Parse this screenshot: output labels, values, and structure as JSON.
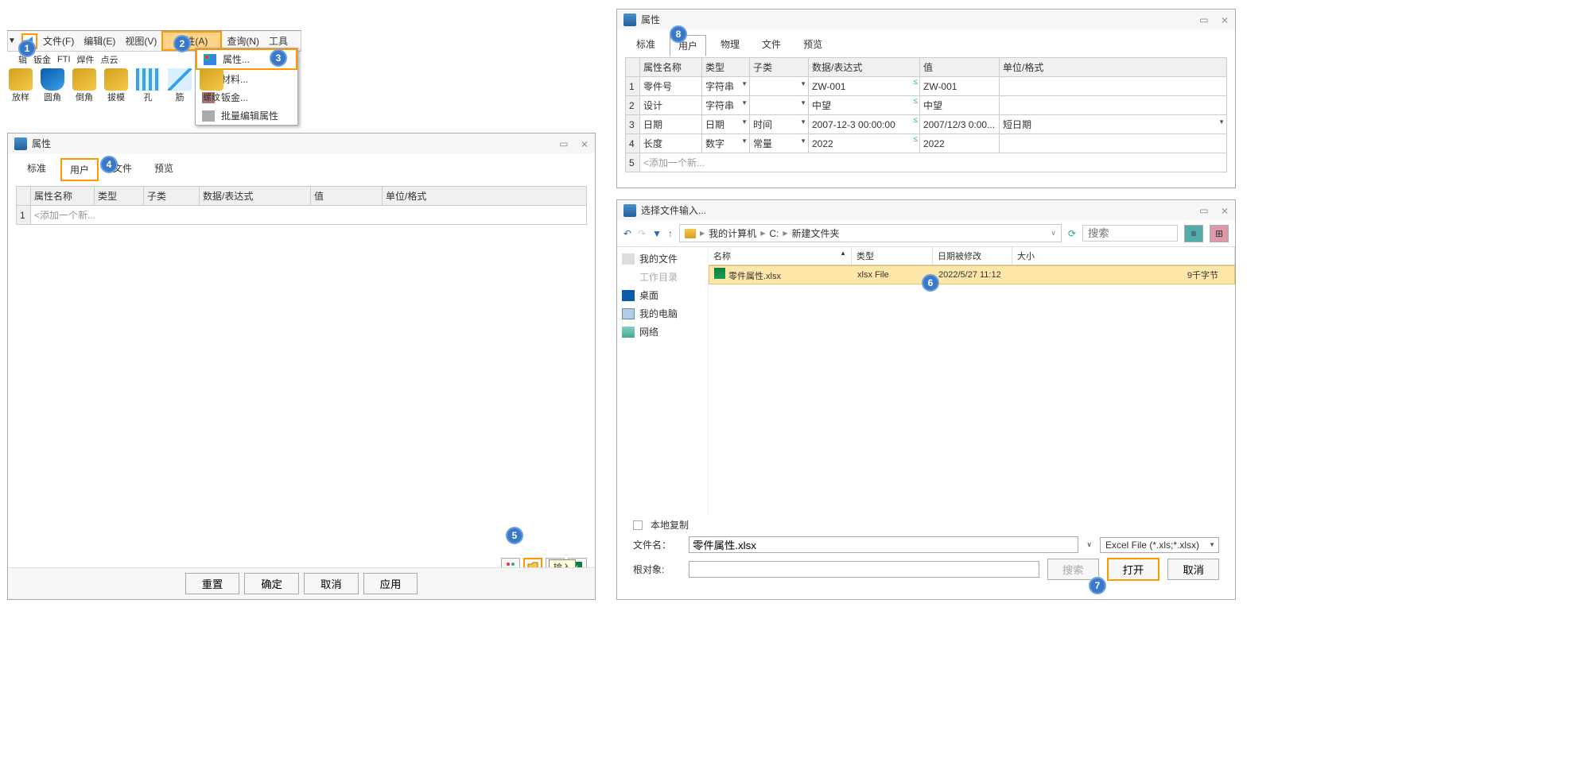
{
  "menu": {
    "items": [
      "文件(F)",
      "编辑(E)",
      "视图(V)",
      "属性(A)",
      "查询(N)",
      "工具"
    ],
    "sub_items": [
      "辑",
      "钣金",
      "FTI",
      "焊件",
      "点云"
    ]
  },
  "dropdown": {
    "items": [
      "属性...",
      "材料...",
      "钣金...",
      "批量编辑属性"
    ]
  },
  "toolbar": {
    "labels": [
      "放样",
      "圆角",
      "倒角",
      "拔模",
      "孔",
      "筋",
      "螺纹"
    ]
  },
  "prop_panel": {
    "title": "属性",
    "tabs": [
      "标准",
      "用户",
      "文件",
      "预览"
    ],
    "cols": [
      "",
      "属性名称",
      "类型",
      "子类",
      "数据/表达式",
      "值",
      "单位/格式"
    ],
    "placeholder": "<添加一个新...",
    "buttons": [
      "重置",
      "确定",
      "取消",
      "应用"
    ],
    "tooltip": "输入"
  },
  "prop_right": {
    "title": "属性",
    "tabs": [
      "标准",
      "用户",
      "物理",
      "文件",
      "预览"
    ],
    "cols": [
      "",
      "属性名称",
      "类型",
      "子类",
      "数据/表达式",
      "值",
      "单位/格式"
    ],
    "rows": [
      {
        "num": "1",
        "name": "零件号",
        "type": "字符串",
        "sub": "",
        "data": "ZW-001",
        "val": "ZW-001",
        "unit": ""
      },
      {
        "num": "2",
        "name": "设计",
        "type": "字符串",
        "sub": "",
        "data": "中望",
        "val": "中望",
        "unit": ""
      },
      {
        "num": "3",
        "name": "日期",
        "type": "日期",
        "sub": "时间",
        "data": "2007-12-3 00:00:00",
        "val": "2007/12/3 0:00...",
        "unit": "短日期"
      },
      {
        "num": "4",
        "name": "长度",
        "type": "数字",
        "sub": "常量",
        "data": "2022",
        "val": "2022",
        "unit": ""
      }
    ],
    "add": "<添加一个新..."
  },
  "file_dlg": {
    "title": "选择文件输入...",
    "path": [
      "我的计算机",
      "C:",
      "新建文件夹"
    ],
    "tree": [
      "我的文件",
      "工作目录",
      "桌面",
      "我的电脑",
      "网络"
    ],
    "cols": [
      "名称",
      "类型",
      "日期被修改",
      "大小"
    ],
    "files": [
      {
        "name": "零件属性.xlsx",
        "type": "xlsx File",
        "date": "2022/5/27 11:12",
        "size": "9千字节"
      }
    ],
    "local_copy": "本地复制",
    "filename_label": "文件名：",
    "filename": "零件属性.xlsx",
    "root_label": "根对象:",
    "filter": "Excel File (*.xls;*.xlsx)",
    "search_btn": "搜索",
    "search_placeholder": "搜索",
    "open_btn": "打开",
    "cancel_btn": "取消"
  }
}
